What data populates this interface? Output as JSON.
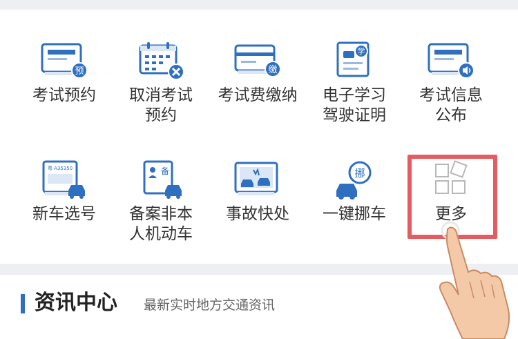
{
  "grid": {
    "row1": [
      {
        "label": "考试预约",
        "badge": "预",
        "icon": "card-icon"
      },
      {
        "label": "取消考试\n预约",
        "icon": "calendar-cancel-icon"
      },
      {
        "label": "考试费缴纳",
        "badge": "缴",
        "icon": "card-pay-icon"
      },
      {
        "label": "电子学习\n驾驶证明",
        "badge": "学",
        "icon": "license-doc-icon"
      },
      {
        "label": "考试信息\n公布",
        "icon": "card-speaker-icon"
      }
    ],
    "row2": [
      {
        "label": "新车选号",
        "icon": "plate-car-icon"
      },
      {
        "label": "备案非本\n人机动车",
        "badge": "备",
        "icon": "record-car-icon"
      },
      {
        "label": "事故快处",
        "icon": "accident-icon"
      },
      {
        "label": "一键挪车",
        "badge": "挪",
        "icon": "move-car-icon"
      },
      {
        "label": "更多",
        "icon": "more-grid-icon"
      }
    ]
  },
  "plate_text": "粤·A35350",
  "news": {
    "title": "资讯中心",
    "subtitle": "最新实时地方交通资讯"
  },
  "colors": {
    "accent": "#2f6fc0",
    "highlight": "#e55b5f",
    "icon_light": "#dbe7f6"
  }
}
